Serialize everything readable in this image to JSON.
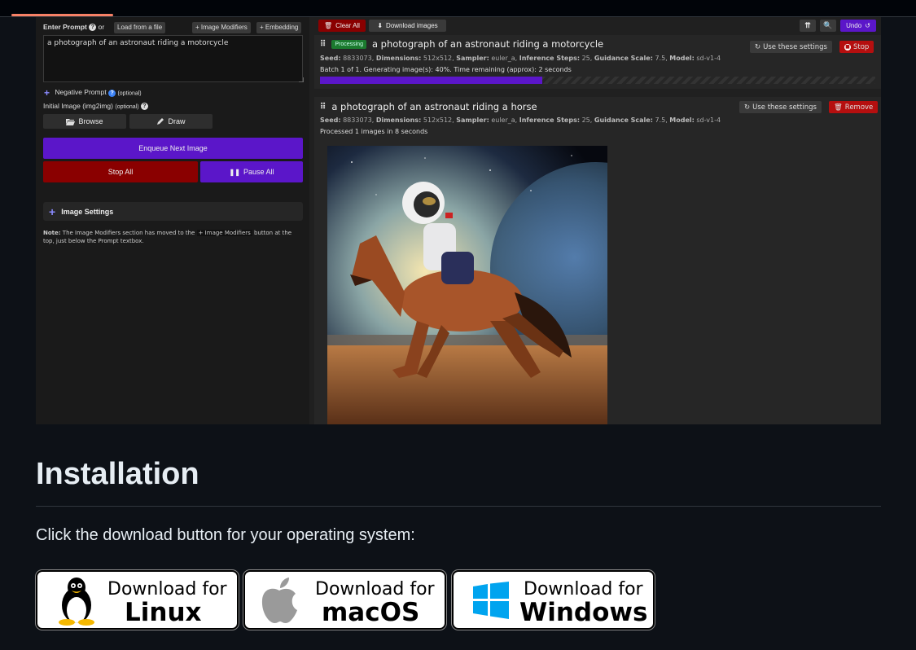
{
  "left": {
    "enter_prompt": "Enter Prompt",
    "or": "or",
    "load_from_file": "Load from a file",
    "image_modifiers": "+ Image Modifiers",
    "embedding": "+ Embedding",
    "prompt_value": "a photograph of an astronaut riding a motorcycle",
    "negative_prompt": "Negative Prompt",
    "optional": "(optional)",
    "initial_image": "Initial Image (img2img)",
    "browse": "Browse",
    "draw": "Draw",
    "enqueue": "Enqueue Next Image",
    "stop_all": "Stop All",
    "pause_all": "Pause All",
    "image_settings": "Image Settings",
    "note_prefix": "Note:",
    "note_text_1": "The Image Modifiers section has moved to the",
    "note_chip": "+ Image Modifiers",
    "note_text_2": "button at the top, just below the Prompt textbox."
  },
  "toolbar": {
    "clear_all": "Clear All",
    "download_images": "Download images",
    "undo": "Undo"
  },
  "task1": {
    "status": "Processing",
    "prompt": "a photograph of an astronaut riding a motorcycle",
    "seed_label": "Seed:",
    "seed": "8833073,",
    "dim_label": "Dimensions:",
    "dim": "512x512,",
    "sampler_label": "Sampler:",
    "sampler": "euler_a,",
    "steps_label": "Inference Steps:",
    "steps": "25,",
    "guidance_label": "Guidance Scale:",
    "guidance": "7.5,",
    "model_label": "Model:",
    "model": "sd-v1-4",
    "progress_text": "Batch 1 of 1. Generating image(s): 40%. Time remaining (approx): 2 seconds",
    "progress": 0.4,
    "use_settings": "Use these settings",
    "stop": "Stop"
  },
  "task2": {
    "prompt": "a photograph of an astronaut riding a horse",
    "seed_label": "Seed:",
    "seed": "8833073,",
    "dim_label": "Dimensions:",
    "dim": "512x512,",
    "sampler_label": "Sampler:",
    "sampler": "euler_a,",
    "steps_label": "Inference Steps:",
    "steps": "25,",
    "guidance_label": "Guidance Scale:",
    "guidance": "7.5,",
    "model_label": "Model:",
    "model": "sd-v1-4",
    "processed_text": "Processed 1 images in 8 seconds",
    "use_settings": "Use these settings",
    "remove": "Remove"
  },
  "page": {
    "heading": "Installation",
    "paragraph": "Click the download button for your operating system:",
    "download_for": "Download for",
    "linux": "Linux",
    "macos": "macOS",
    "windows": "Windows"
  },
  "colors": {
    "purple": "#5b16c9",
    "red": "#8a0000",
    "bright_red": "#b50f0f",
    "green_pill": "#1b7a2e",
    "windows_blue": "#00a4ef"
  }
}
